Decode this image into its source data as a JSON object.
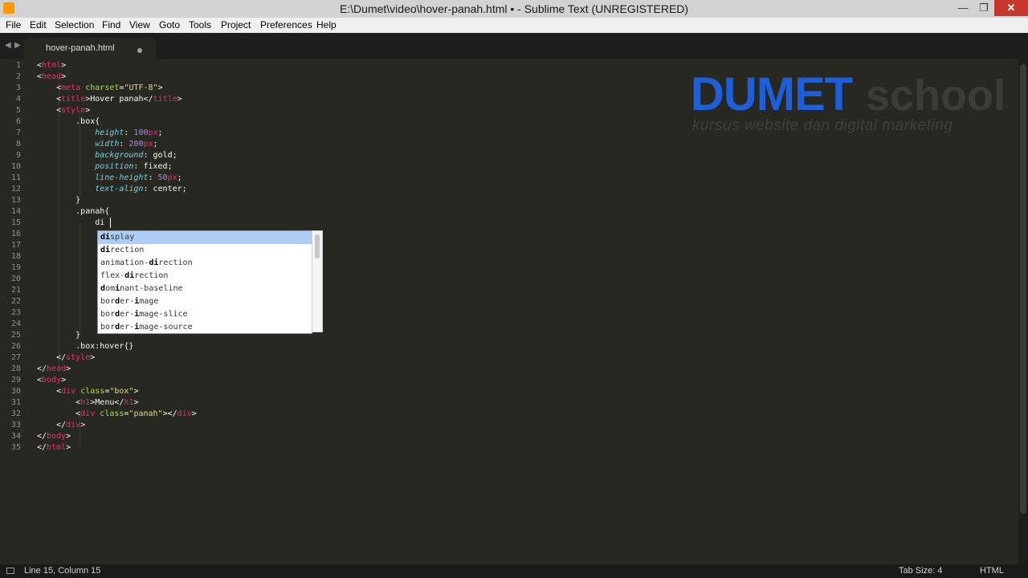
{
  "window": {
    "title": "E:\\Dumet\\video\\hover-panah.html • - Sublime Text (UNREGISTERED)",
    "minimize_symbol": "—",
    "maximize_symbol": "❐",
    "close_symbol": "✕"
  },
  "menu": [
    "File",
    "Edit",
    "Selection",
    "Find",
    "View",
    "Goto",
    "Tools",
    "Project",
    "Preferences",
    "Help"
  ],
  "tabs": [
    {
      "label": "hover-panah.html",
      "dirty": true
    }
  ],
  "nav": {
    "left": "◀",
    "right": "▶"
  },
  "line_numbers": [
    "1",
    "2",
    "3",
    "4",
    "5",
    "6",
    "7",
    "8",
    "9",
    "10",
    "11",
    "12",
    "13",
    "14",
    "15",
    "16",
    "17",
    "18",
    "19",
    "20",
    "21",
    "22",
    "23",
    "24",
    "25",
    "26",
    "27",
    "28",
    "29",
    "30",
    "31",
    "32",
    "33",
    "34",
    "35"
  ],
  "code_lines": [
    "<html>",
    "<head>",
    "    <meta charset=\"UTF-8\">",
    "    <title>Hover panah</title>",
    "    <style>",
    "        .box{",
    "            height: 100px;",
    "            width: 200px;",
    "            background: gold;",
    "            position: fixed;",
    "            line-height: 50px;",
    "            text-align: center;",
    "        }",
    "        .panah{",
    "            di",
    "",
    "",
    "",
    "",
    "",
    "",
    "",
    "",
    "",
    "        }",
    "        .box:hover{}",
    "    </style>",
    "</head>",
    "<body>",
    "    <div class=\"box\">",
    "        <h1>Menu</h1>",
    "        <div class=\"panah\"></div>",
    "    </div>",
    "</body>",
    "</html>"
  ],
  "autocomplete": {
    "typed": "di",
    "items": [
      "display",
      "direction",
      "animation-direction",
      "flex-direction",
      "dominant-baseline",
      "border-image",
      "border-image-slice",
      "border-image-source"
    ],
    "selected_index": 0
  },
  "watermark": {
    "brand": "DUMET",
    "school": "school",
    "tagline": "kursus website dan digital marketing"
  },
  "status": {
    "position": "Line 15, Column 15",
    "tab_size": "Tab Size: 4",
    "syntax": "HTML"
  },
  "colors": {
    "background": "#272822",
    "tag": "#f92672",
    "attribute": "#a6e22e",
    "string": "#e6db74",
    "property": "#66d9ef",
    "number": "#ae81ff",
    "brand": "#1e5fd9"
  }
}
